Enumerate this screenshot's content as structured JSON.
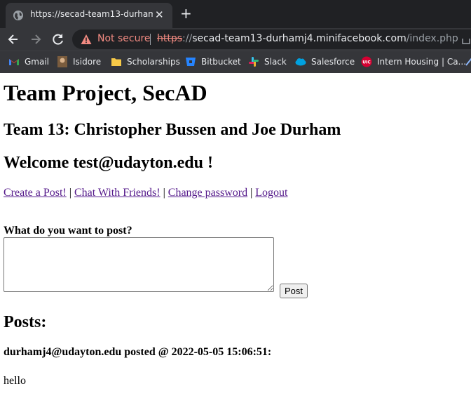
{
  "browser": {
    "tab": {
      "title": "https://secad-team13-durhamj4.mi",
      "close": "✕",
      "new_tab": "+"
    },
    "address": {
      "security_label": "Not secure",
      "url_scheme": "https",
      "url_slashes": "://",
      "url_host": "secad-team13-durhamj4.minifacebook.com",
      "url_path": "/index.php"
    },
    "bookmarks": [
      {
        "label": "Gmail",
        "icon": "gmail-icon"
      },
      {
        "label": "Isidore",
        "icon": "isidore-icon"
      },
      {
        "label": "Scholarships",
        "icon": "folder-icon"
      },
      {
        "label": "Bitbucket",
        "icon": "bitbucket-icon"
      },
      {
        "label": "Slack",
        "icon": "slack-icon"
      },
      {
        "label": "Salesforce",
        "icon": "salesforce-icon"
      },
      {
        "label": "Intern Housing | Ca...",
        "icon": "uic-icon"
      }
    ]
  },
  "page": {
    "title": "Team Project, SecAD",
    "team": "Team 13: Christopher Bussen and Joe Durham",
    "welcome": "Welcome test@udayton.edu !",
    "nav": {
      "create_post": "Create a Post!",
      "chat": "Chat With Friends!",
      "change_password": "Change password",
      "logout": "Logout",
      "separator": "|"
    },
    "form": {
      "prompt": "What do you want to post?",
      "post_button": "Post"
    },
    "posts_heading": "Posts:",
    "posts": [
      {
        "header": "durhamj4@udayton.edu posted @ 2022-05-05 15:06:51:",
        "content": "hello"
      }
    ]
  }
}
